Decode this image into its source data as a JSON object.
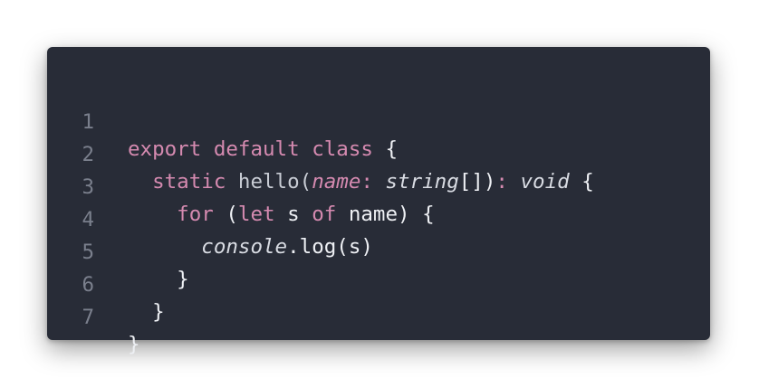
{
  "editor": {
    "line_numbers": [
      "1",
      "2",
      "3",
      "4",
      "5",
      "6",
      "7"
    ],
    "lines": [
      [
        {
          "text": "export default class",
          "style": "keyword"
        },
        {
          "text": " {",
          "style": "plain"
        }
      ],
      [
        {
          "text": "  static",
          "style": "keyword"
        },
        {
          "text": " hello(",
          "style": "function"
        },
        {
          "text": "name",
          "style": "param"
        },
        {
          "text": ":",
          "style": "keyword"
        },
        {
          "text": " ",
          "style": "plain"
        },
        {
          "text": "string",
          "style": "type"
        },
        {
          "text": "[])",
          "style": "plain"
        },
        {
          "text": ":",
          "style": "keyword"
        },
        {
          "text": " ",
          "style": "plain"
        },
        {
          "text": "void",
          "style": "type"
        },
        {
          "text": " {",
          "style": "plain"
        }
      ],
      [
        {
          "text": "    for",
          "style": "keyword"
        },
        {
          "text": " (",
          "style": "plain"
        },
        {
          "text": "let",
          "style": "keyword"
        },
        {
          "text": " s ",
          "style": "plain"
        },
        {
          "text": "of",
          "style": "keyword"
        },
        {
          "text": " name) {",
          "style": "plain"
        }
      ],
      [
        {
          "text": "      ",
          "style": "plain"
        },
        {
          "text": "console",
          "style": "type"
        },
        {
          "text": ".log(s)",
          "style": "plain"
        }
      ],
      [
        {
          "text": "    }",
          "style": "plain"
        }
      ],
      [
        {
          "text": "  }",
          "style": "plain"
        }
      ],
      [
        {
          "text": "}",
          "style": "plain"
        }
      ]
    ]
  },
  "colors": {
    "background": "#282c37",
    "keyword": "#d58ab0",
    "plain": "#eef0f4",
    "line_number": "#7a7f8c"
  }
}
